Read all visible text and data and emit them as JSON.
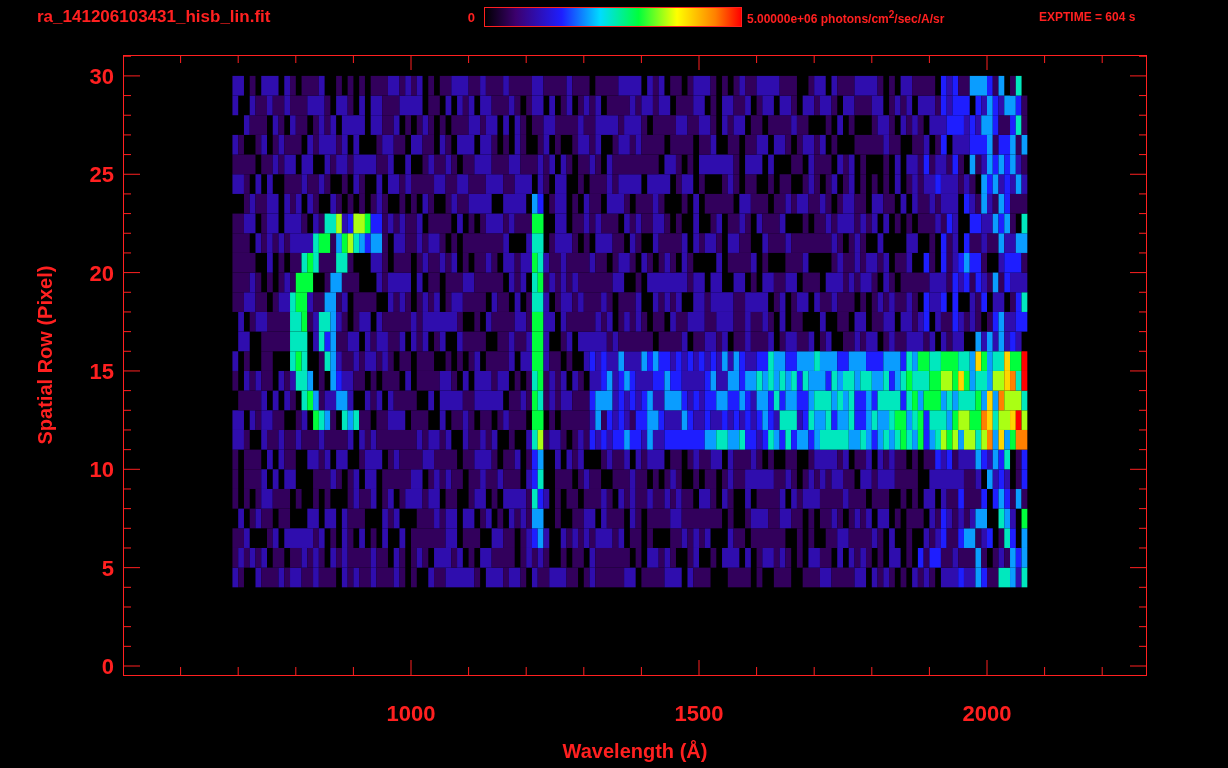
{
  "header": {
    "title": "ra_141206103431_hisb_lin.fit",
    "colorbar": {
      "min_label": "0",
      "max_label": "5.00000e+06 photons/cm$^{2}$/sec/A/sr"
    },
    "exposure": "EXPTIME = 604 s"
  },
  "plot": {
    "x_axis": {
      "label": "Wavelength (Å)",
      "ticks": [
        "1000",
        "1500",
        "2000"
      ]
    },
    "y_axis": {
      "label": "Spatial Row (Pixel)",
      "ticks": [
        "30",
        "25",
        "20",
        "15",
        "10",
        "5",
        "0"
      ]
    }
  }
}
